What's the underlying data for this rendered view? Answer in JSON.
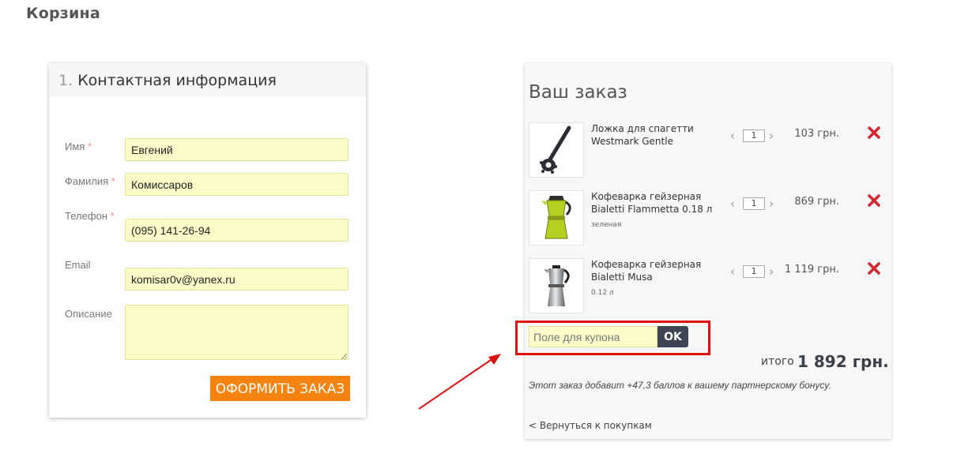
{
  "page": {
    "title": "Корзина"
  },
  "contact": {
    "heading_num": "1.",
    "heading_text": "Контактная информация",
    "required_mark": "*",
    "fields": {
      "name": {
        "label": "Имя",
        "value": "Евгений"
      },
      "surname": {
        "label": "Фамилия",
        "value": "Комиссаров"
      },
      "phone": {
        "label": "Телефон",
        "value": "(095) 141-26-94"
      },
      "email": {
        "label": "Email",
        "value": "komisar0v@yanex.ru"
      },
      "description": {
        "label": "Описание",
        "value": ""
      }
    },
    "submit_label": "ОФОРМИТЬ ЗАКАЗ"
  },
  "order": {
    "title": "Ваш заказ",
    "items": [
      {
        "name": "Ложка для спагетти Westmark Gentle",
        "variant": "",
        "qty": "1",
        "price": "103 грн.",
        "image": "spaghetti-spoon"
      },
      {
        "name": "Кофеварка гейзерная Bialetti Flammetta 0.18 л",
        "variant": "зеленая",
        "qty": "1",
        "price": "869 грн.",
        "image": "green-moka-pot"
      },
      {
        "name": "Кофеварка гейзерная Bialetti Musa",
        "variant": "0.12 л",
        "qty": "1",
        "price": "1 119 грн.",
        "image": "steel-moka-pot"
      }
    ],
    "coupon": {
      "placeholder": "Поле для купона",
      "button": "OK"
    },
    "total_label": "итого",
    "total_value": "1 892 грн.",
    "bonus_note": "Этот заказ добавит +47,3 баллов к вашему партнерскому бонусу.",
    "back_link": "< Вернуться к покупкам"
  },
  "colors": {
    "accent_orange": "#f4830f",
    "input_yellow": "#fdfcc9",
    "coupon_button": "#3e4553",
    "remove_red": "#d9232d",
    "annotation_red": "#dd1111"
  },
  "icons": {
    "remove": "close-x-icon",
    "qty_decrease": "chevron-left-icon",
    "qty_increase": "chevron-right-icon"
  }
}
